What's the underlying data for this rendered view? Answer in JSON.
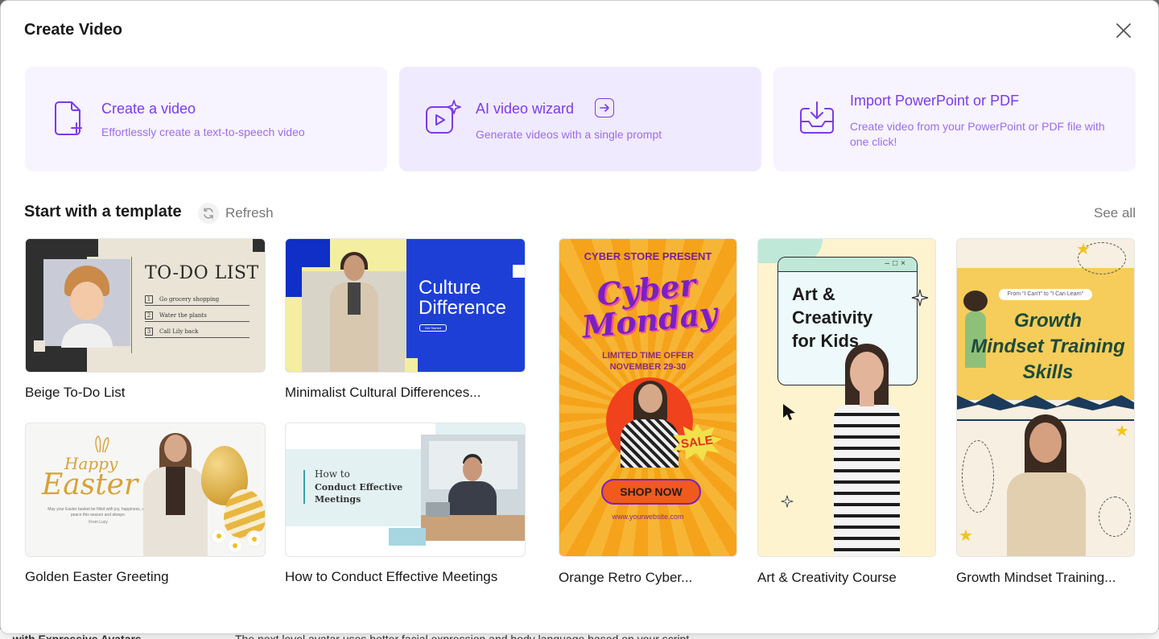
{
  "modal": {
    "title": "Create Video",
    "close_icon": "close-icon"
  },
  "actions": [
    {
      "title": "Create a video",
      "description": "Effortlessly create a text-to-speech video",
      "icon": "file-plus-icon"
    },
    {
      "title": "AI video wizard",
      "description": "Generate videos with a single prompt",
      "icon": "ai-video-icon",
      "trailing_icon": "arrow-right-box-icon"
    },
    {
      "title": "Import PowerPoint or PDF",
      "description": "Create video from your PowerPoint or PDF file with one click!",
      "icon": "import-tray-icon"
    }
  ],
  "templates_section": {
    "title": "Start with a template",
    "refresh_label": "Refresh",
    "see_all_label": "See all"
  },
  "templates": [
    {
      "caption": "Beige To-Do List",
      "thumb": {
        "title": "TO-DO LIST",
        "items": [
          {
            "num": "1",
            "text": "Go grocery shopping"
          },
          {
            "num": "2",
            "text": "Water the plants"
          },
          {
            "num": "3",
            "text": "Call Lily back"
          }
        ]
      }
    },
    {
      "caption": "Minimalist Cultural Differences...",
      "thumb": {
        "title_line1": "Culture",
        "title_line2": "Difference",
        "button": "Get Started"
      }
    },
    {
      "caption": "Golden Easter Greeting",
      "thumb": {
        "line1": "Happy",
        "line2": "Easter",
        "message": "May your Easter basket be filled with joy, happiness, and peace this season and always.",
        "from": "From Lucy"
      }
    },
    {
      "caption": "How to Conduct Effective Meetings",
      "thumb": {
        "line1": "How to",
        "line2": "Conduct Effective",
        "line3": "Meetings"
      }
    },
    {
      "caption": "Orange Retro Cyber...",
      "thumb": {
        "store": "CYBER STORE PRESENT",
        "line1": "Cyber",
        "line2": "Monday",
        "offer": "LIMITED TIME OFFER",
        "dates": "NOVEMBER 29-30",
        "sale": "SALE",
        "cta": "SHOP NOW",
        "website": "www.yourwebsite.com"
      }
    },
    {
      "caption": "Art & Creativity Course",
      "thumb": {
        "line1": "Art &",
        "line2": "Creativity",
        "line3": "for Kids"
      }
    },
    {
      "caption": "Growth Mindset Training...",
      "thumb": {
        "pill": "From \"I Can't\" to \"I Can Learn\"",
        "line1": "Growth",
        "line2": "Mindset Training",
        "line3": "Skills"
      }
    }
  ],
  "colors": {
    "accent": "#7b3ce6",
    "card_bg": "#f7f3ff",
    "card_bg_active": "#f0eafe"
  },
  "background_text": {
    "left": "...with Expressive Avatars",
    "right": "The next level avatar uses better facial expression and body language based on your script"
  }
}
